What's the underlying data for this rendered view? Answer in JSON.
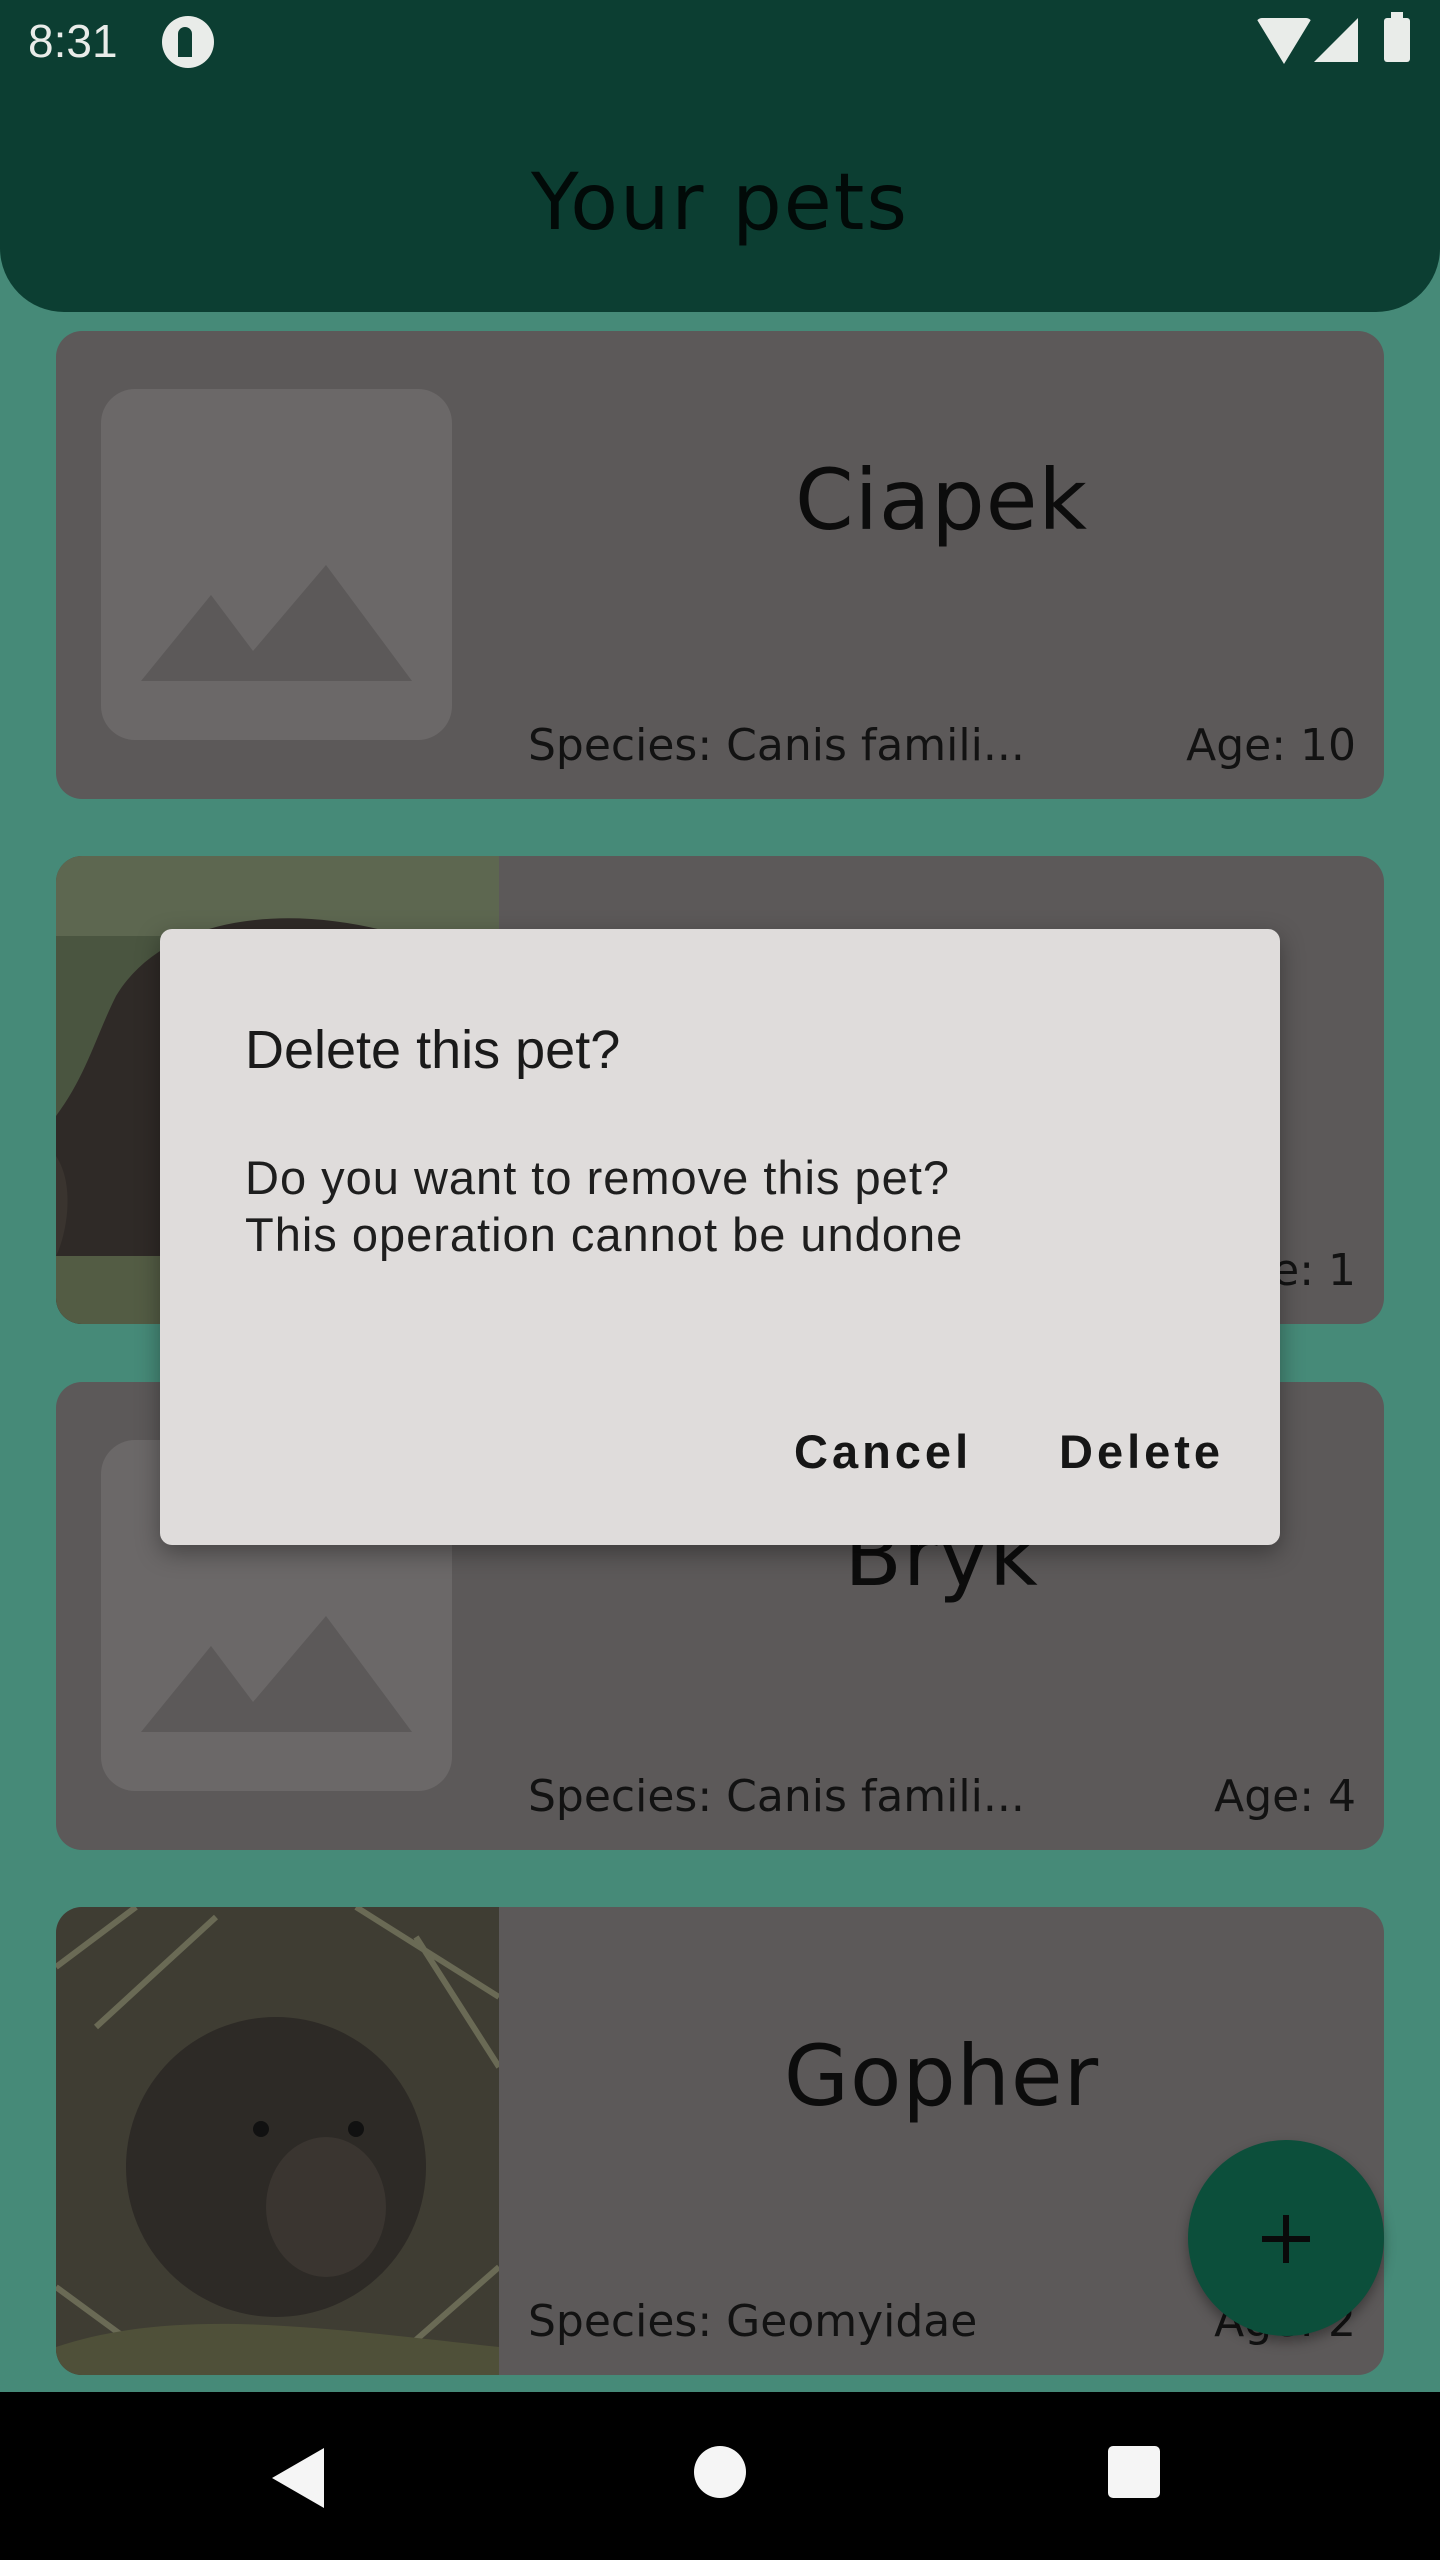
{
  "status_bar": {
    "time": "8:31"
  },
  "header": {
    "title": "Your pets"
  },
  "pets": [
    {
      "name": "Ciapek",
      "species": "Species: Canis famili...",
      "age": "Age: 10",
      "image": "placeholder-icon"
    },
    {
      "name": "",
      "species": "",
      "age": "ge: 1",
      "image": "donkey-photo"
    },
    {
      "name": "Bryk",
      "species": "Species: Canis famili...",
      "age": "Age: 4",
      "image": "placeholder-icon"
    },
    {
      "name": "Gopher",
      "species": "Species: Geomyidae",
      "age": "Age: 2",
      "image": "gopher-photo"
    }
  ],
  "dialog": {
    "title": "Delete this pet?",
    "message_line1": "Do you want to remove this pet?",
    "message_line2": "This operation cannot be undone",
    "cancel_label": "Cancel",
    "delete_label": "Delete"
  },
  "fab": {
    "icon": "plus-icon"
  },
  "nav": {
    "back_icon": "back-icon",
    "home_icon": "home-icon",
    "recents_icon": "recents-icon"
  },
  "colors": {
    "app_bar": "#0c3e32",
    "scrim_background": "#468a78",
    "card": "#5c5959",
    "dialog": "#dfdcdb",
    "fab": "#0c4f3b"
  }
}
